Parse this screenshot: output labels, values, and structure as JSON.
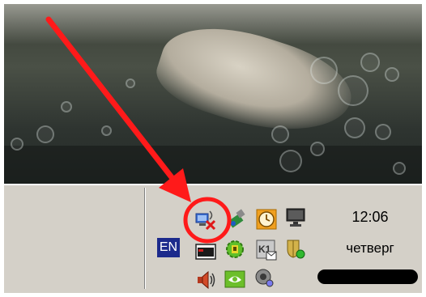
{
  "tray": {
    "language_indicator": "EN",
    "clock": {
      "time": "12:06",
      "day": "четверг"
    },
    "icons": [
      "network-disconnected-icon",
      "usb-drive-icon",
      "clock-alarm-icon",
      "monitor-icon",
      "taskbar-window-icon",
      "green-gear-icon",
      "k1-mail-icon",
      "shield-icon",
      "speaker-volume-icon",
      "nvidia-icon",
      "sound-device-icon"
    ]
  },
  "annotation": {
    "arrow_color": "#ff1a1a",
    "circle_color": "#ff1a1a"
  },
  "colors": {
    "taskbar": "#d4d0c8",
    "language_badge": "#1c2a8c"
  }
}
